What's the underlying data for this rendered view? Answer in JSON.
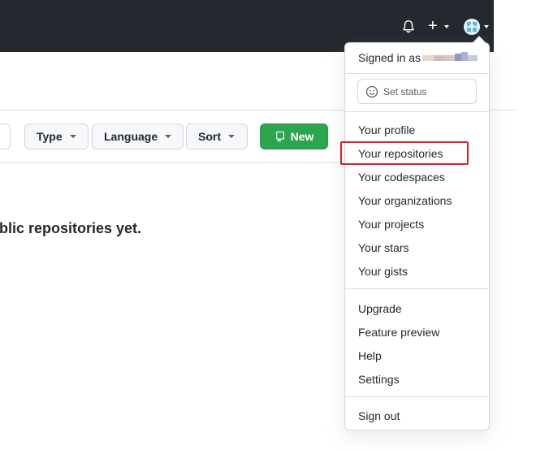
{
  "header": {
    "bell_icon": "bell-icon",
    "plus_icon": "plus-icon",
    "plus_glyph": "+",
    "avatar_icon": "avatar-icon"
  },
  "filters": {
    "type_label": "Type",
    "language_label": "Language",
    "sort_label": "Sort",
    "new_label": "New"
  },
  "main": {
    "empty_message": "ublic repositories yet."
  },
  "dropdown": {
    "signed_in_label": "Signed in as",
    "set_status_label": "Set status",
    "items": [
      "Your profile",
      "Your repositories",
      "Your codespaces",
      "Your organizations",
      "Your projects",
      "Your stars",
      "Your gists",
      "Upgrade",
      "Feature preview",
      "Help",
      "Settings",
      "Sign out"
    ],
    "highlighted_item": "Your repositories"
  },
  "colors": {
    "header_bg": "#24292f",
    "new_button_bg": "#2da44e",
    "highlight_border": "#d1242f"
  }
}
